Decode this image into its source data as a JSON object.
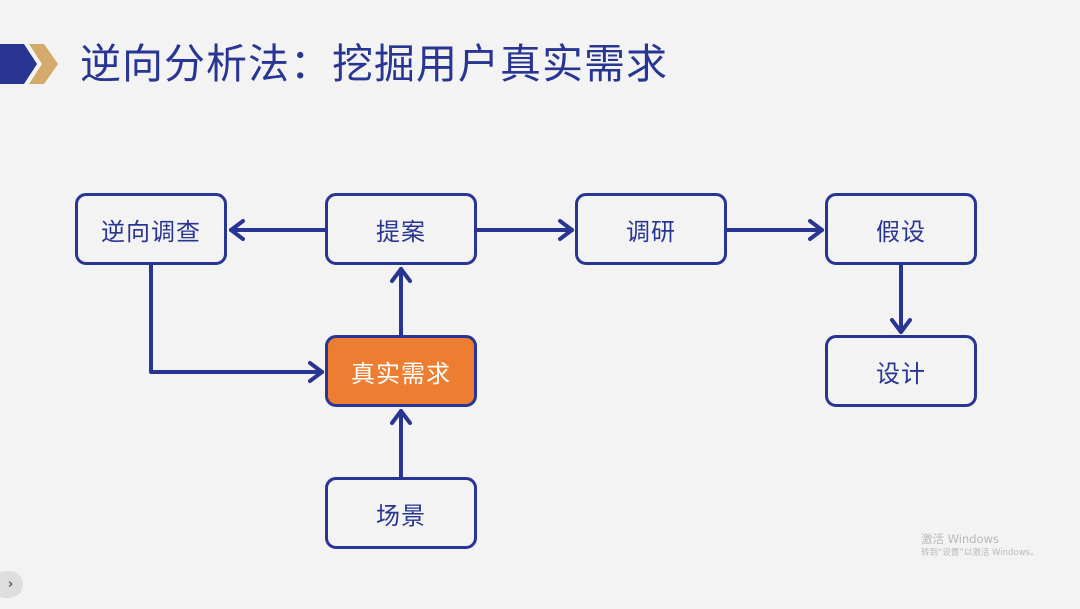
{
  "slide": {
    "title": "逆向分析法：挖掘用户真实需求",
    "logo_icon": "double-chevron-icon",
    "colors": {
      "background": "#f3f3f3",
      "primary": "#283592",
      "accent": "#d4aa6a",
      "highlight": "#ed7d31",
      "highlight_text": "#ffffff"
    }
  },
  "diagram": {
    "nodes": [
      {
        "id": "reverse-survey",
        "label": "逆向调查"
      },
      {
        "id": "proposal",
        "label": "提案"
      },
      {
        "id": "research",
        "label": "调研"
      },
      {
        "id": "hypothesis",
        "label": "假设"
      },
      {
        "id": "real-needs",
        "label": "真实需求",
        "highlighted": true
      },
      {
        "id": "design",
        "label": "设计"
      },
      {
        "id": "scenario",
        "label": "场景"
      }
    ],
    "edges": [
      {
        "from": "proposal",
        "to": "reverse-survey"
      },
      {
        "from": "proposal",
        "to": "research"
      },
      {
        "from": "research",
        "to": "hypothesis"
      },
      {
        "from": "hypothesis",
        "to": "design"
      },
      {
        "from": "reverse-survey",
        "to": "real-needs"
      },
      {
        "from": "real-needs",
        "to": "proposal"
      },
      {
        "from": "scenario",
        "to": "real-needs"
      }
    ]
  },
  "watermark": {
    "line1": "激活 Windows",
    "line2": "转到“设置”以激活 Windows。"
  },
  "nav": {
    "next_icon": "chevron-right-icon",
    "next_glyph": "›"
  }
}
